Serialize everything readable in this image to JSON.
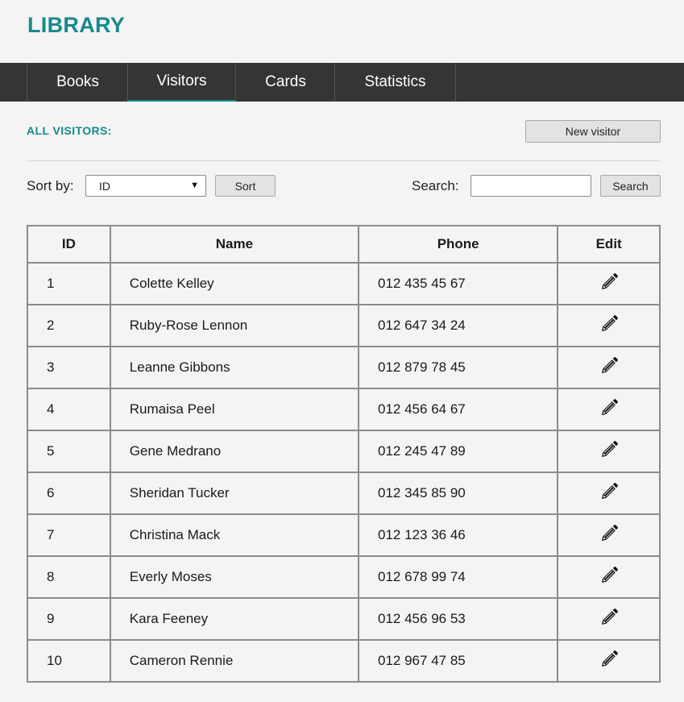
{
  "app": {
    "title": "LIBRARY"
  },
  "nav": {
    "tabs": [
      {
        "label": "Books"
      },
      {
        "label": "Visitors"
      },
      {
        "label": "Cards"
      },
      {
        "label": "Statistics"
      }
    ],
    "active_tab": "Visitors"
  },
  "page": {
    "section_title": "ALL VISITORS:",
    "new_visitor_label": "New visitor"
  },
  "controls": {
    "sort_label": "Sort by:",
    "sort_value": "ID",
    "sort_button": "Sort",
    "search_label": "Search:",
    "search_value": "",
    "search_placeholder": "",
    "search_button": "Search"
  },
  "table": {
    "headers": {
      "id": "ID",
      "name": "Name",
      "phone": "Phone",
      "edit": "Edit"
    },
    "edit_icon": "pencil-icon",
    "rows": [
      {
        "id": "1",
        "name": "Colette Kelley",
        "phone": "012 435 45 67"
      },
      {
        "id": "2",
        "name": "Ruby-Rose Lennon",
        "phone": "012 647 34 24"
      },
      {
        "id": "3",
        "name": "Leanne Gibbons",
        "phone": "012 879 78 45"
      },
      {
        "id": "4",
        "name": "Rumaisa Peel",
        "phone": "012 456 64 67"
      },
      {
        "id": "5",
        "name": "Gene Medrano",
        "phone": "012 245 47 89"
      },
      {
        "id": "6",
        "name": "Sheridan Tucker",
        "phone": "012 345 85 90"
      },
      {
        "id": "7",
        "name": "Christina Mack",
        "phone": "012 123 36 46"
      },
      {
        "id": "8",
        "name": "Everly Moses",
        "phone": "012 678 99 74"
      },
      {
        "id": "9",
        "name": "Kara Feeney",
        "phone": "012 456 96 53"
      },
      {
        "id": "10",
        "name": "Cameron Rennie",
        "phone": "012 967 47 85"
      }
    ]
  },
  "colors": {
    "accent": "#17898c",
    "navbar": "#353535",
    "background": "#f4f4f4"
  }
}
